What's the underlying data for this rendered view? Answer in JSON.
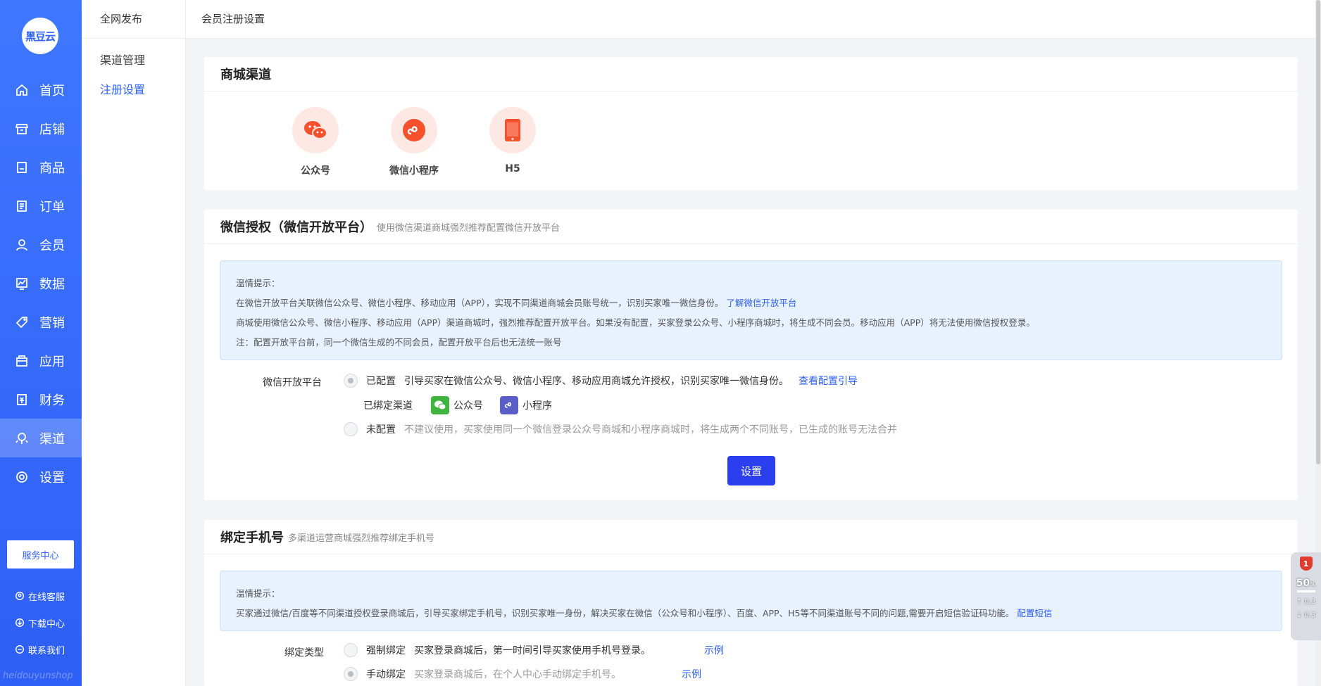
{
  "app": {
    "logo_text": "黑豆云",
    "watermark": "heidouyunshop"
  },
  "nav": {
    "items": [
      {
        "label": "首页",
        "icon": "home-icon"
      },
      {
        "label": "店铺",
        "icon": "store-icon"
      },
      {
        "label": "商品",
        "icon": "goods-icon"
      },
      {
        "label": "订单",
        "icon": "order-icon"
      },
      {
        "label": "会员",
        "icon": "member-icon"
      },
      {
        "label": "数据",
        "icon": "data-icon"
      },
      {
        "label": "营销",
        "icon": "tag-icon"
      },
      {
        "label": "应用",
        "icon": "app-icon"
      },
      {
        "label": "财务",
        "icon": "finance-icon"
      },
      {
        "label": "渠道",
        "icon": "channel-icon",
        "active": true
      },
      {
        "label": "设置",
        "icon": "gear-icon"
      }
    ],
    "service_center": "服务中心",
    "links": [
      "在线客服",
      "下载中心",
      "联系我们"
    ]
  },
  "subnav": {
    "head": "全网发布",
    "items": [
      "渠道管理",
      "注册设置"
    ],
    "active": "注册设置"
  },
  "topbar": {
    "title": "会员注册设置"
  },
  "channels_card": {
    "title": "商城渠道",
    "channels": [
      {
        "label": "公众号",
        "icon": "wechat-icon"
      },
      {
        "label": "微信小程序",
        "icon": "miniprogram-icon"
      },
      {
        "label": "H5",
        "icon": "mobile-icon"
      }
    ]
  },
  "auth_card": {
    "title": "微信授权（微信开放平台）",
    "subtitle": "使用微信渠道商城强烈推荐配置微信开放平台",
    "tip_title": "温情提示：",
    "tip_line1": "在微信开放平台关联微信公众号、微信小程序、移动应用（APP），实现不同渠道商城会员账号统一，识别买家唯一微信身份。",
    "tip_link1": "了解微信开放平台",
    "tip_line2": "商城使用微信公众号、微信小程序、移动应用（APP）渠道商城时，强烈推荐配置开放平台。如果没有配置，买家登录公众号、小程序商城时，将生成不同会员。移动应用（APP）将无法使用微信授权登录。",
    "tip_line3": "注：配置开放平台前，同一个微信生成的不同会员，配置开放平台后也无法统一账号",
    "field_label": "微信开放平台",
    "opt1_label": "已配置",
    "opt1_desc": "引导买家在微信公众号、微信小程序、移动应用商城允许授权，识别买家唯一微信身份。",
    "opt1_link": "查看配置引导",
    "bound_label": "已绑定渠道",
    "bound_1": "公众号",
    "bound_2": "小程序",
    "opt2_label": "未配置",
    "opt2_desc": "不建议使用，买家使用同一个微信登录公众号商城和小程序商城时，将生成两个不同账号，已生成的账号无法合并",
    "button": "设置"
  },
  "phone_card": {
    "title": "绑定手机号",
    "subtitle": "多渠道运营商城强烈推荐绑定手机号",
    "tip_title": "温情提示：",
    "tip_line1": "买家通过微信/百度等不同渠道授权登录商城后，引导买家绑定手机号，识别买家唯一身份，解决买家在微信（公众号和小程序）、百度、APP、H5等不同渠道账号不同的问题,需要开启短信验证码功能。",
    "tip_link1": "配置短信",
    "field_label": "绑定类型",
    "opt1_label": "强制绑定",
    "opt1_desc": "买家登录商城后，第一时间引导买家使用手机号登录。",
    "opt1_link": "示例",
    "opt2_label": "手动绑定",
    "opt2_desc": "买家登录商城后，在个人中心手动绑定手机号。",
    "opt2_link": "示例"
  },
  "widget": {
    "badge": "1",
    "percent": "50",
    "up": "0.3",
    "down": "0.3"
  },
  "colors": {
    "brand": "#2e5ff6",
    "button": "#2b3fef",
    "wechat_green": "#3fb33f",
    "miniprogram_purple": "#5a5fc8",
    "channel_icon": "#f4512c"
  }
}
